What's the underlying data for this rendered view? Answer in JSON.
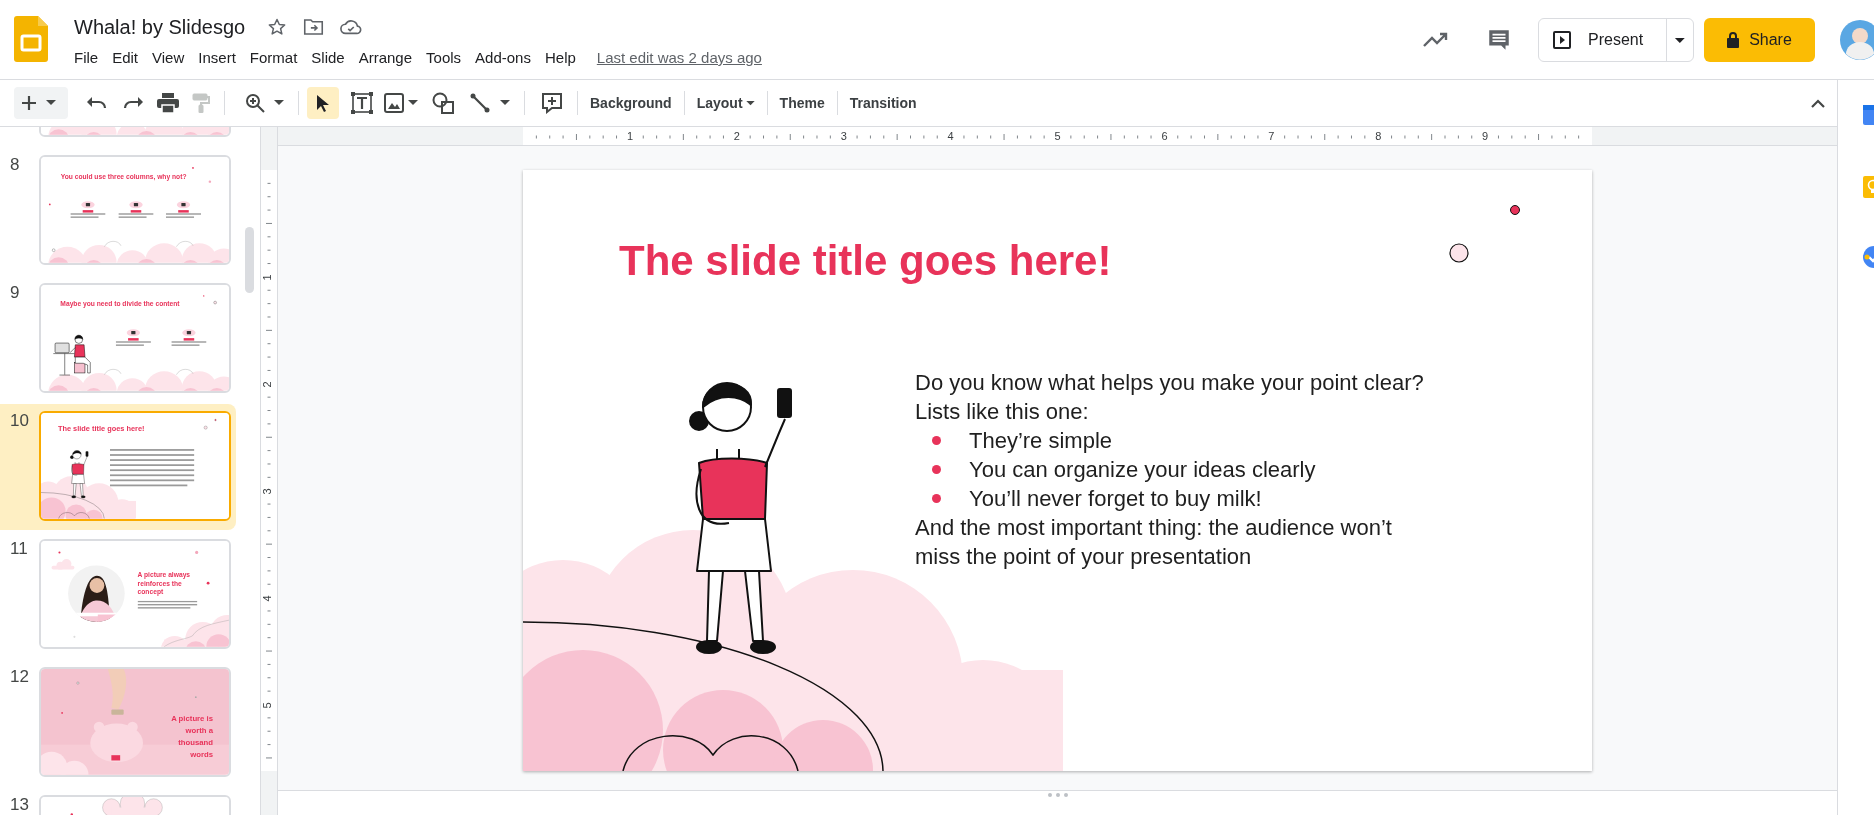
{
  "document": {
    "title": "Whala! by Slidesgo"
  },
  "menu": [
    "File",
    "Edit",
    "View",
    "Insert",
    "Format",
    "Slide",
    "Arrange",
    "Tools",
    "Add-ons",
    "Help"
  ],
  "last_edit": "Last edit was 2 days ago",
  "header_buttons": {
    "present": "Present",
    "share": "Share"
  },
  "toolbar": {
    "select_active": true,
    "paint_format_disabled": true,
    "text_buttons": [
      {
        "label": "Background",
        "dropdown": false
      },
      {
        "label": "Layout",
        "dropdown": true
      },
      {
        "label": "Theme",
        "dropdown": false
      },
      {
        "label": "Transition",
        "dropdown": false
      }
    ]
  },
  "rulers": {
    "horizontal": [
      "1",
      "2",
      "3",
      "4",
      "5",
      "6",
      "7",
      "8",
      "9"
    ],
    "vertical": [
      "1",
      "2",
      "3",
      "4",
      "5"
    ]
  },
  "slides": [
    {
      "kind": "clouds-bottom",
      "selected": false
    },
    {
      "number": "8",
      "kind": "columns",
      "selected": false,
      "title": "You could use three columns, why not?"
    },
    {
      "number": "9",
      "kind": "split",
      "selected": false,
      "title": "Maybe you need to divide the content"
    },
    {
      "number": "10",
      "kind": "list",
      "selected": true,
      "title": "The slide title goes here!"
    },
    {
      "number": "11",
      "kind": "picture",
      "selected": false,
      "title": "A picture always reinforces the concept"
    },
    {
      "number": "12",
      "selected": false,
      "title": "A picture is worth a thousand words"
    },
    {
      "number": "13",
      "kind": "clouds-top",
      "selected": false
    }
  ],
  "current_slide": {
    "kind": "list",
    "title": "The slide title goes here!",
    "body": [
      {
        "kind": "text",
        "text": "Do you know what helps you make your point clear?"
      },
      {
        "kind": "text",
        "text": "Lists like this one:"
      },
      {
        "kind": "bullet",
        "text": "They’re simple"
      },
      {
        "kind": "bullet",
        "text": "You can organize your ideas clearly"
      },
      {
        "kind": "bullet",
        "text": "You’ll never forget to buy milk!"
      },
      {
        "kind": "text",
        "text": "And the most important thing: the audience won’t miss the point of your presentation"
      }
    ]
  }
}
